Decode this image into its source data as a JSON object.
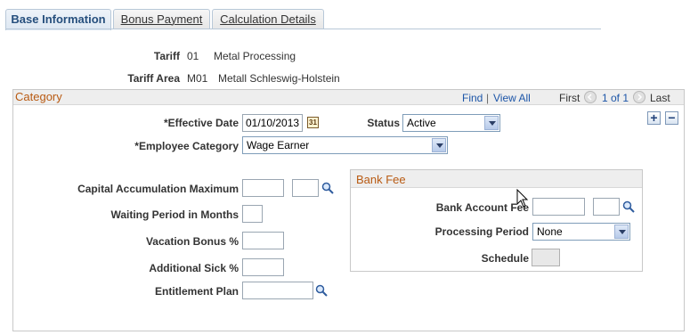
{
  "tabs": [
    {
      "label": "Base Information"
    },
    {
      "label": "Bonus Payment"
    },
    {
      "label": "Calculation Details"
    }
  ],
  "header": {
    "tariff_label": "Tariff",
    "tariff_code": "01",
    "tariff_name": "Metal Processing",
    "tariff_area_label": "Tariff Area",
    "tariff_area_code": "M01",
    "tariff_area_name": "Metall Schleswig-Holstein"
  },
  "category": {
    "title": "Category",
    "find": "Find",
    "separator": "|",
    "view_all": "View All",
    "first": "First",
    "pager": "1 of 1",
    "last": "Last",
    "effective_date_label": "*Effective Date",
    "effective_date_value": "01/10/2013",
    "status_label": "Status",
    "status_value": "Active",
    "employee_category_label": "*Employee Category",
    "employee_category_value": "Wage Earner",
    "capital_accumulation_label": "Capital Accumulation Maximum",
    "waiting_period_label": "Waiting Period in Months",
    "vacation_bonus_label": "Vacation Bonus %",
    "additional_sick_label": "Additional Sick %",
    "entitlement_plan_label": "Entitlement Plan",
    "add_label": "+",
    "remove_label": "−"
  },
  "bank_fee": {
    "title": "Bank Fee",
    "bank_account_fee_label": "Bank Account Fee",
    "processing_period_label": "Processing Period",
    "processing_period_value": "None",
    "schedule_label": "Schedule"
  },
  "icons": {
    "lookup": "magnifier-icon",
    "calendar": "calendar-icon",
    "previous": "previous-arrow-icon",
    "next": "next-arrow-icon"
  }
}
